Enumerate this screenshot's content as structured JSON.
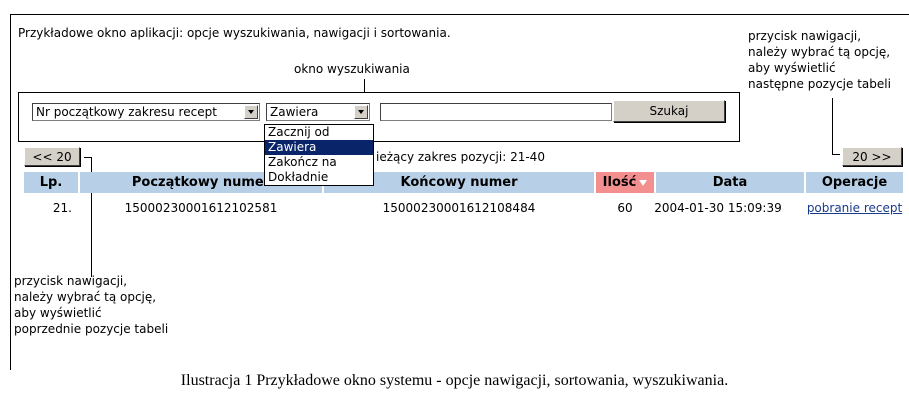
{
  "intro_text": "Przykładowe okno aplikacji: opcje wyszukiwania, nawigacji i sortowania.",
  "search_box_label": "okno wyszukiwania",
  "annotation_next": [
    "przycisk nawigacji,",
    "należy wybrać tą opcję,",
    "aby wyświetlić",
    "następne pozycje tabeli"
  ],
  "annotation_prev": [
    "przycisk nawigacji,",
    "należy wybrać tą opcję,",
    "aby wyświetlić",
    "poprzednie pozycje tabeli"
  ],
  "search": {
    "field_select_value": "Nr początkowy zakresu recept",
    "mode_select_value": "Zawiera",
    "text_value": "",
    "button_label": "Szukaj",
    "mode_options": [
      "Zacznij od",
      "Zawiera",
      "Zakończ na",
      "Dokładnie"
    ],
    "selected_option_index": 1
  },
  "nav": {
    "prev_label": "<< 20",
    "next_label": "20 >>",
    "range_text": "ieżący zakres pozycji: 21-40"
  },
  "table": {
    "headers": [
      "Lp.",
      "Początkowy numer",
      "Końcowy numer",
      "Ilość",
      "Data",
      "Operacje"
    ],
    "sorted_column": "Ilość",
    "rows": [
      [
        "21.",
        "15000230001612102581",
        "15000230001612108484",
        "60",
        "2004-01-30 15:09:39",
        "pobranie recept"
      ]
    ]
  },
  "colors": {
    "header_bg": "#b7d0e8",
    "sorted_header_bg": "#f48f8f",
    "selected_option_bg": "#0a246a",
    "link": "#1a3a8a"
  },
  "caption": "Ilustracja 1 Przykładowe okno systemu - opcje nawigacji, sortowania, wyszukiwania."
}
